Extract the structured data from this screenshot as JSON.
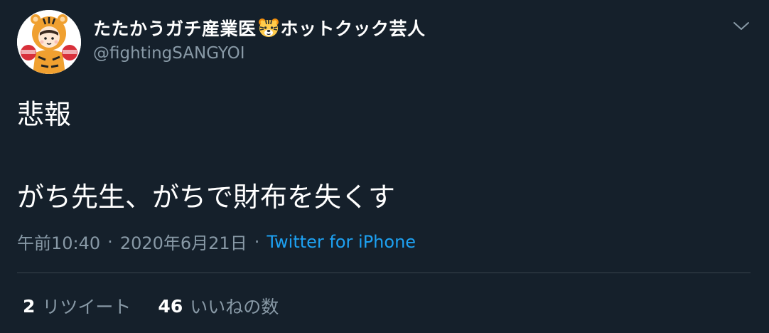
{
  "tweet": {
    "display_name_prefix": "たたかうガチ産業医",
    "name_emoji": "tiger-face-icon",
    "display_name_suffix": "ホットクック芸人",
    "handle": "@fightingSANGYOI",
    "text": "悲報\n\nがち先生、がちで財布を失くす",
    "time": "午前10:40",
    "date": "2020年6月21日",
    "separator": "·",
    "source": "Twitter for iPhone",
    "retweets": {
      "count": "2",
      "label": "リツイート"
    },
    "likes": {
      "count": "46",
      "label": "いいねの数"
    }
  },
  "colors": {
    "background": "#15202b",
    "secondary_text": "#8899a6",
    "link": "#1da1f2",
    "divider": "#38444d"
  }
}
